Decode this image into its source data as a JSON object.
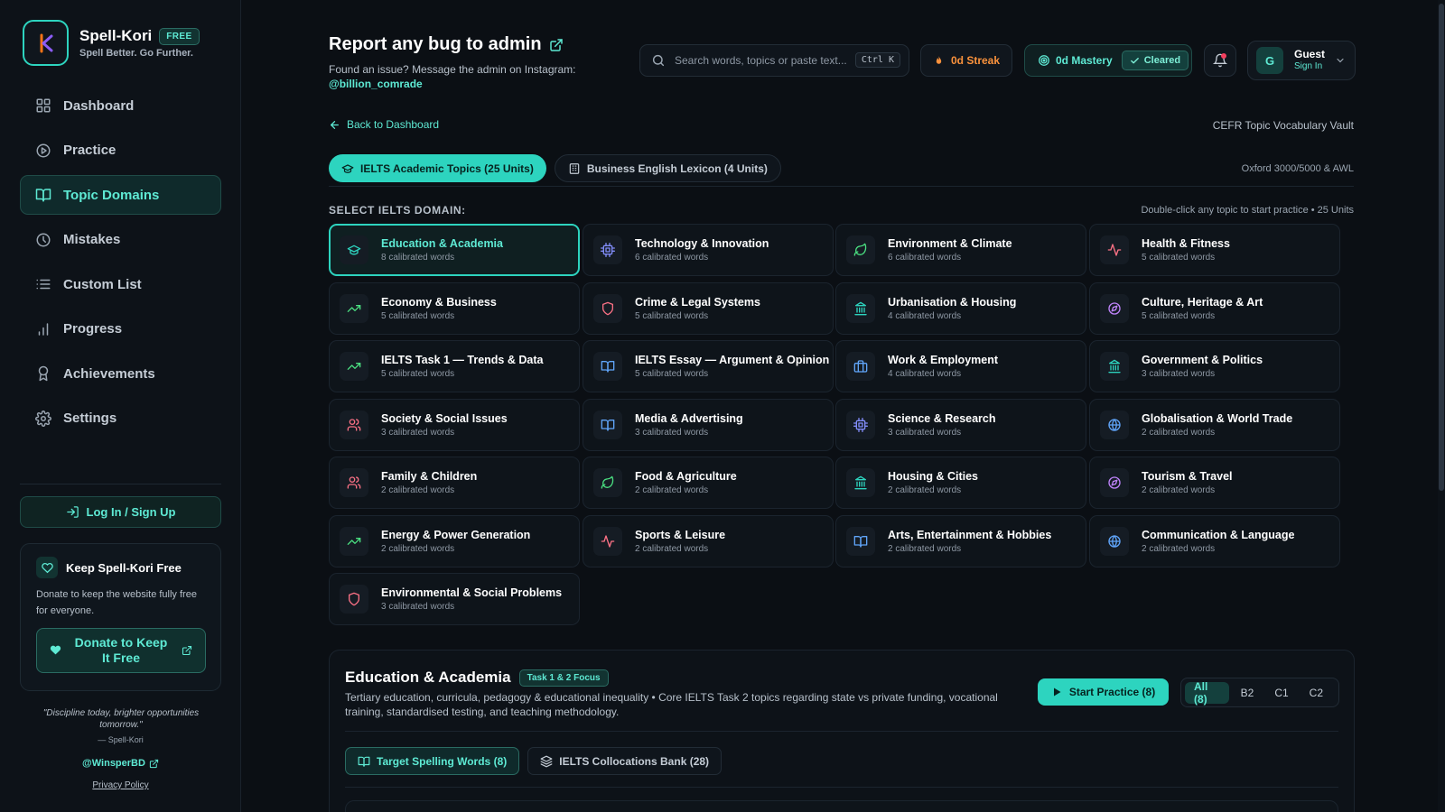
{
  "brand": {
    "name": "Spell-Kori",
    "badge": "FREE",
    "tagline": "Spell Better. Go Further."
  },
  "sidebar": {
    "items": [
      {
        "label": "Dashboard",
        "icon": "grid-icon",
        "active": false
      },
      {
        "label": "Practice",
        "icon": "play-circle-icon",
        "active": false
      },
      {
        "label": "Topic Domains",
        "icon": "book-open-icon",
        "active": true
      },
      {
        "label": "Mistakes",
        "icon": "clock-icon",
        "active": false
      },
      {
        "label": "Custom List",
        "icon": "list-icon",
        "active": false
      },
      {
        "label": "Progress",
        "icon": "bar-chart-icon",
        "active": false
      },
      {
        "label": "Achievements",
        "icon": "award-icon",
        "active": false
      },
      {
        "label": "Settings",
        "icon": "gear-icon",
        "active": false
      }
    ],
    "login_label": "Log In / Sign Up",
    "donate": {
      "title": "Keep Spell-Kori Free",
      "text": "Donate to keep the website fully free for everyone.",
      "button_label": "Donate to Keep It Free"
    },
    "quote": "\"Discipline today, brighter opportunities tomorrow.\"",
    "quote_author": "— Spell-Kori",
    "social_handle": "@WinsperBD",
    "privacy_label": "Privacy Policy"
  },
  "header": {
    "title": "Report any bug to admin",
    "subtitle": "Found an issue? Message the admin on Instagram:",
    "handle": "@billion_comrade",
    "search_placeholder": "Search words, topics or paste text...",
    "search_shortcut": "Ctrl K",
    "streak_label": "0d Streak",
    "mastery_label": "0d Mastery",
    "cleared_label": "Cleared",
    "user_initial": "G",
    "user_name": "Guest",
    "user_sub": "Sign In"
  },
  "page": {
    "back_label": "Back to Dashboard",
    "vault_title": "CEFR Topic Vocabulary Vault",
    "tabs": [
      {
        "label": "IELTS Academic Topics (25 Units)",
        "icon": "graduation-cap-icon",
        "active": true
      },
      {
        "label": "Business English Lexicon (4 Units)",
        "icon": "building-icon",
        "active": false
      }
    ],
    "tabs_note": "Oxford 3000/5000 & AWL",
    "section_label": "SELECT IELTS DOMAIN:",
    "section_hint": "Double-click any topic to start practice • 25 Units"
  },
  "topics": [
    {
      "title": "Education & Academia",
      "sub": "8 calibrated words",
      "icon": "graduation-cap-icon",
      "color": "#2dd4bf",
      "selected": true
    },
    {
      "title": "Technology & Innovation",
      "sub": "6 calibrated words",
      "icon": "cpu-icon",
      "color": "#818cf8"
    },
    {
      "title": "Environment & Climate",
      "sub": "6 calibrated words",
      "icon": "leaf-icon",
      "color": "#4ade80"
    },
    {
      "title": "Health & Fitness",
      "sub": "5 calibrated words",
      "icon": "activity-icon",
      "color": "#fb7185"
    },
    {
      "title": "Economy & Business",
      "sub": "5 calibrated words",
      "icon": "trending-up-icon",
      "color": "#4ade80"
    },
    {
      "title": "Crime & Legal Systems",
      "sub": "5 calibrated words",
      "icon": "shield-icon",
      "color": "#fb7185"
    },
    {
      "title": "Urbanisation & Housing",
      "sub": "4 calibrated words",
      "icon": "landmark-icon",
      "color": "#2dd4bf"
    },
    {
      "title": "Culture, Heritage & Art",
      "sub": "5 calibrated words",
      "icon": "compass-icon",
      "color": "#c084fc"
    },
    {
      "title": "IELTS Task 1 — Trends & Data",
      "sub": "5 calibrated words",
      "icon": "trending-up-icon",
      "color": "#4ade80"
    },
    {
      "title": "IELTS Essay — Argument & Opinion",
      "sub": "5 calibrated words",
      "icon": "book-open-icon",
      "color": "#60a5fa"
    },
    {
      "title": "Work & Employment",
      "sub": "4 calibrated words",
      "icon": "briefcase-icon",
      "color": "#60a5fa"
    },
    {
      "title": "Government & Politics",
      "sub": "3 calibrated words",
      "icon": "landmark-icon",
      "color": "#2dd4bf"
    },
    {
      "title": "Society & Social Issues",
      "sub": "3 calibrated words",
      "icon": "users-icon",
      "color": "#fb7185"
    },
    {
      "title": "Media & Advertising",
      "sub": "3 calibrated words",
      "icon": "book-open-icon",
      "color": "#60a5fa"
    },
    {
      "title": "Science & Research",
      "sub": "3 calibrated words",
      "icon": "cpu-icon",
      "color": "#818cf8"
    },
    {
      "title": "Globalisation & World Trade",
      "sub": "2 calibrated words",
      "icon": "globe-icon",
      "color": "#60a5fa"
    },
    {
      "title": "Family & Children",
      "sub": "2 calibrated words",
      "icon": "users-icon",
      "color": "#fb7185"
    },
    {
      "title": "Food & Agriculture",
      "sub": "2 calibrated words",
      "icon": "leaf-icon",
      "color": "#4ade80"
    },
    {
      "title": "Housing & Cities",
      "sub": "2 calibrated words",
      "icon": "landmark-icon",
      "color": "#2dd4bf"
    },
    {
      "title": "Tourism & Travel",
      "sub": "2 calibrated words",
      "icon": "compass-icon",
      "color": "#c084fc"
    },
    {
      "title": "Energy & Power Generation",
      "sub": "2 calibrated words",
      "icon": "trending-up-icon",
      "color": "#4ade80"
    },
    {
      "title": "Sports & Leisure",
      "sub": "2 calibrated words",
      "icon": "activity-icon",
      "color": "#fb7185"
    },
    {
      "title": "Arts, Entertainment & Hobbies",
      "sub": "2 calibrated words",
      "icon": "book-open-icon",
      "color": "#60a5fa"
    },
    {
      "title": "Communication & Language",
      "sub": "2 calibrated words",
      "icon": "globe-icon",
      "color": "#60a5fa"
    },
    {
      "title": "Environmental & Social Problems",
      "sub": "3 calibrated words",
      "icon": "shield-icon",
      "color": "#fb7185"
    }
  ],
  "detail": {
    "title": "Education & Academia",
    "badge": "Task 1 & 2 Focus",
    "description": "Tertiary education, curricula, pedagogy & educational inequality • Core IELTS Task 2 topics regarding state vs private funding, vocational training, standardised testing, and teaching methodology.",
    "start_label": "Start Practice (8)",
    "levels": [
      {
        "label": "All (8)",
        "active": true
      },
      {
        "label": "B2",
        "active": false
      },
      {
        "label": "C1",
        "active": false
      },
      {
        "label": "C2",
        "active": false
      }
    ],
    "subtabs": [
      {
        "label": "Target Spelling Words (8)",
        "icon": "book-open-icon",
        "active": true
      },
      {
        "label": "IELTS Collocations Bank (28)",
        "icon": "layers-icon",
        "active": false
      }
    ]
  }
}
